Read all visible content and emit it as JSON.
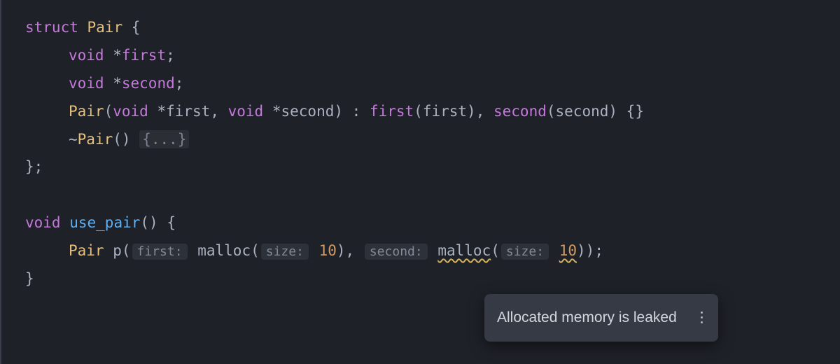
{
  "code": {
    "struct_kw": "struct",
    "struct_name": "Pair",
    "open_brace": " {",
    "void_star1_type": "void",
    "void_star1_star": " *",
    "member_first": "first",
    "semicolon": ";",
    "void_star2_type": "void",
    "void_star2_star": " *",
    "member_second": "second",
    "ctor_name": "Pair",
    "ctor_params_open": "(",
    "ctor_p1_type": "void",
    "ctor_p1_star": " *",
    "ctor_p1_name": "first",
    "comma_sp": ", ",
    "ctor_p2_type": "void",
    "ctor_p2_star": " *",
    "ctor_p2_name": "second",
    "ctor_params_close": ")",
    "ctor_colon": " : ",
    "init_first": "first",
    "init_first_arg_open": "(",
    "init_first_arg": "first",
    "init_first_arg_close": ")",
    "init_comma": ", ",
    "init_second": "second",
    "init_second_arg_open": "(",
    "init_second_arg": "second",
    "init_second_arg_close": ")",
    "ctor_body": " {}",
    "dtor_tilde": "~",
    "dtor_name": "Pair",
    "dtor_parens": "()",
    "dtor_space": " ",
    "fold_content": "{...}",
    "close_brace": "};",
    "func_ret": "void",
    "func_name": "use_pair",
    "func_parens": "()",
    "func_open": " {",
    "var_type": "Pair",
    "var_name": "p",
    "var_paren_open": "(",
    "inlay_first": "first:",
    "malloc1": "malloc",
    "malloc1_open": "(",
    "inlay_size1": "size:",
    "malloc1_arg": "10",
    "malloc1_close": ")",
    "arg_comma": ", ",
    "inlay_second": "second:",
    "malloc2": "malloc",
    "malloc2_open": "(",
    "inlay_size2": "size:",
    "malloc2_arg": "10",
    "malloc2_close": ")",
    "var_close": ");",
    "func_close": "}"
  },
  "tooltip": {
    "message": "Allocated memory is leaked"
  }
}
